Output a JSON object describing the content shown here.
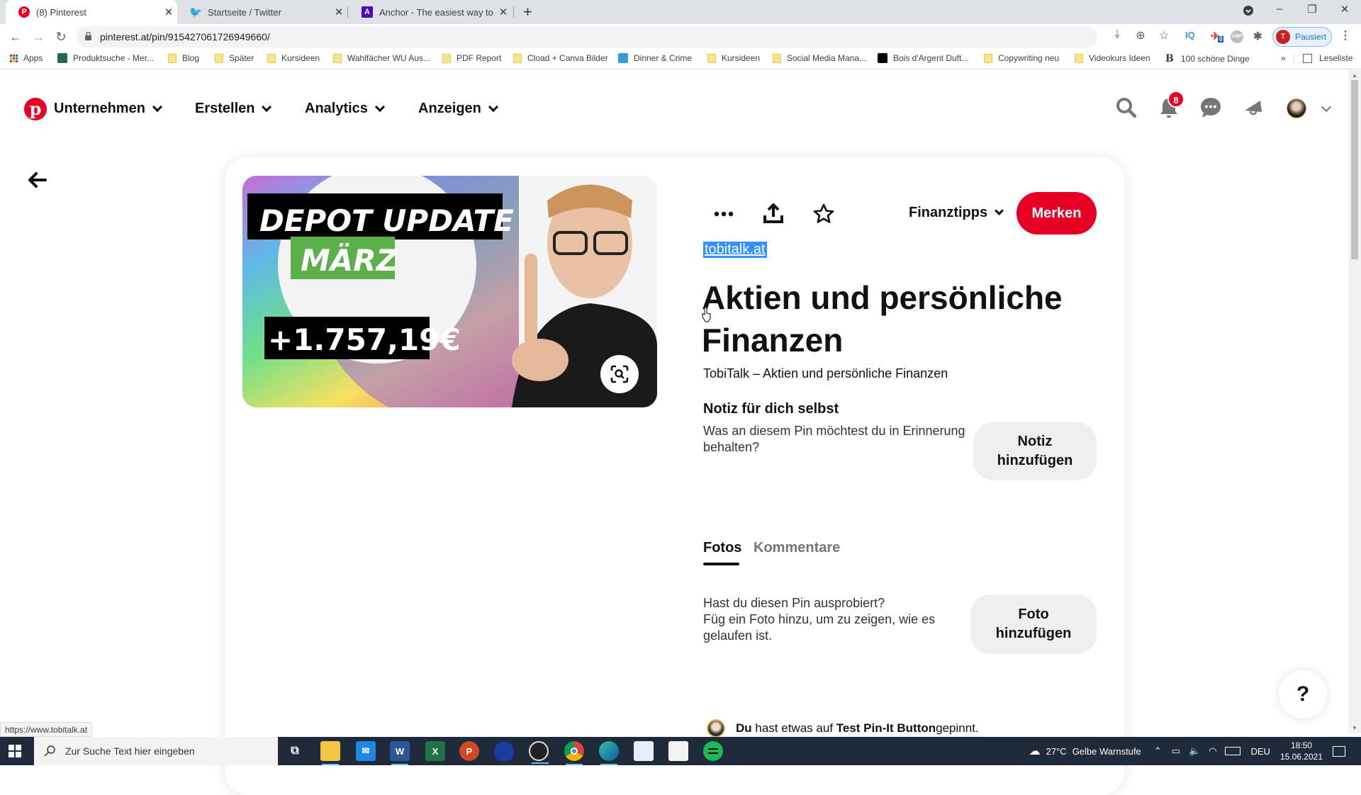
{
  "browser": {
    "tabs": [
      {
        "title": "(8) Pinterest",
        "icon": "pinterest-icon",
        "active": true
      },
      {
        "title": "Startseite / Twitter",
        "icon": "twitter-icon",
        "active": false
      },
      {
        "title": "Anchor - The easiest way to mak",
        "icon": "anchor-icon",
        "active": false
      }
    ],
    "new_tab_label": "+",
    "url": "pinterest.at/pin/915427061726949660/",
    "profile_initial": "T",
    "profile_status": "Pausiert",
    "extension_badge": "0",
    "extension_iq_label": "IQ",
    "bookmarks": [
      {
        "label": "Apps",
        "type": "apps"
      },
      {
        "label": "Produktsuche - Mer...",
        "type": "site"
      },
      {
        "label": "Blog",
        "type": "folder"
      },
      {
        "label": "Später",
        "type": "folder"
      },
      {
        "label": "Kursideen",
        "type": "folder"
      },
      {
        "label": "Wahlfächer WU Aus...",
        "type": "folder"
      },
      {
        "label": "PDF Report",
        "type": "folder"
      },
      {
        "label": "Cload + Canva Bilder",
        "type": "folder"
      },
      {
        "label": "Dinner & Crime",
        "type": "site"
      },
      {
        "label": "Kursideen",
        "type": "folder"
      },
      {
        "label": "Social Media Mana...",
        "type": "folder"
      },
      {
        "label": "Bois d'Argent Duft...",
        "type": "site"
      },
      {
        "label": "Copywriting neu",
        "type": "folder"
      },
      {
        "label": "Videokurs Ideen",
        "type": "folder"
      },
      {
        "label": "100 schöne Dinge",
        "type": "site"
      }
    ],
    "bookmarks_overflow": "»",
    "reading_list": "Leseliste",
    "status_url": "https://www.tobitalk.at"
  },
  "pinterest": {
    "nav": [
      {
        "label": "Unternehmen"
      },
      {
        "label": "Erstellen"
      },
      {
        "label": "Analytics"
      },
      {
        "label": "Anzeigen"
      }
    ],
    "notification_count": "8",
    "pin": {
      "image_text": {
        "headline": "DEPOT UPDATE",
        "month": "MÄRZ",
        "amount": "+1.757,19€"
      },
      "board": "Finanztipps",
      "save_label": "Merken",
      "source": "tobitalk.at",
      "title": "Aktien und persönliche Finanzen",
      "description": "TobiTalk – Aktien und persönliche Finanzen",
      "note_heading": "Notiz für dich selbst",
      "note_text": "Was an diesem Pin möchtest du in Erinnerung behalten?",
      "note_button": "Notiz hinzufügen",
      "tabs": [
        {
          "label": "Fotos",
          "active": true
        },
        {
          "label": "Kommentare",
          "active": false
        }
      ],
      "photo_text_1": "Hast du diesen Pin ausprobiert?",
      "photo_text_2": "Füg ein Foto hinzu, um zu zeigen, wie es gelaufen ist.",
      "photo_button": "Foto hinzufügen",
      "activity": {
        "actor": "Du",
        "middle": " hast etwas auf ",
        "board": "Test Pin-It Button",
        "end": " gepinnt."
      }
    },
    "help_label": "?"
  },
  "taskbar": {
    "search_placeholder": "Zur Suche Text hier eingeben",
    "apps": [
      "task-view",
      "file-explorer",
      "mail",
      "word",
      "excel",
      "powerpoint",
      "app-blue",
      "obs",
      "chrome",
      "edge",
      "app-doc",
      "app-doc2",
      "spotify"
    ],
    "weather_temp": "27°C",
    "weather_text": "Gelbe Warnstufe",
    "language": "DEU",
    "time": "18:50",
    "date": "15.06.2021"
  }
}
